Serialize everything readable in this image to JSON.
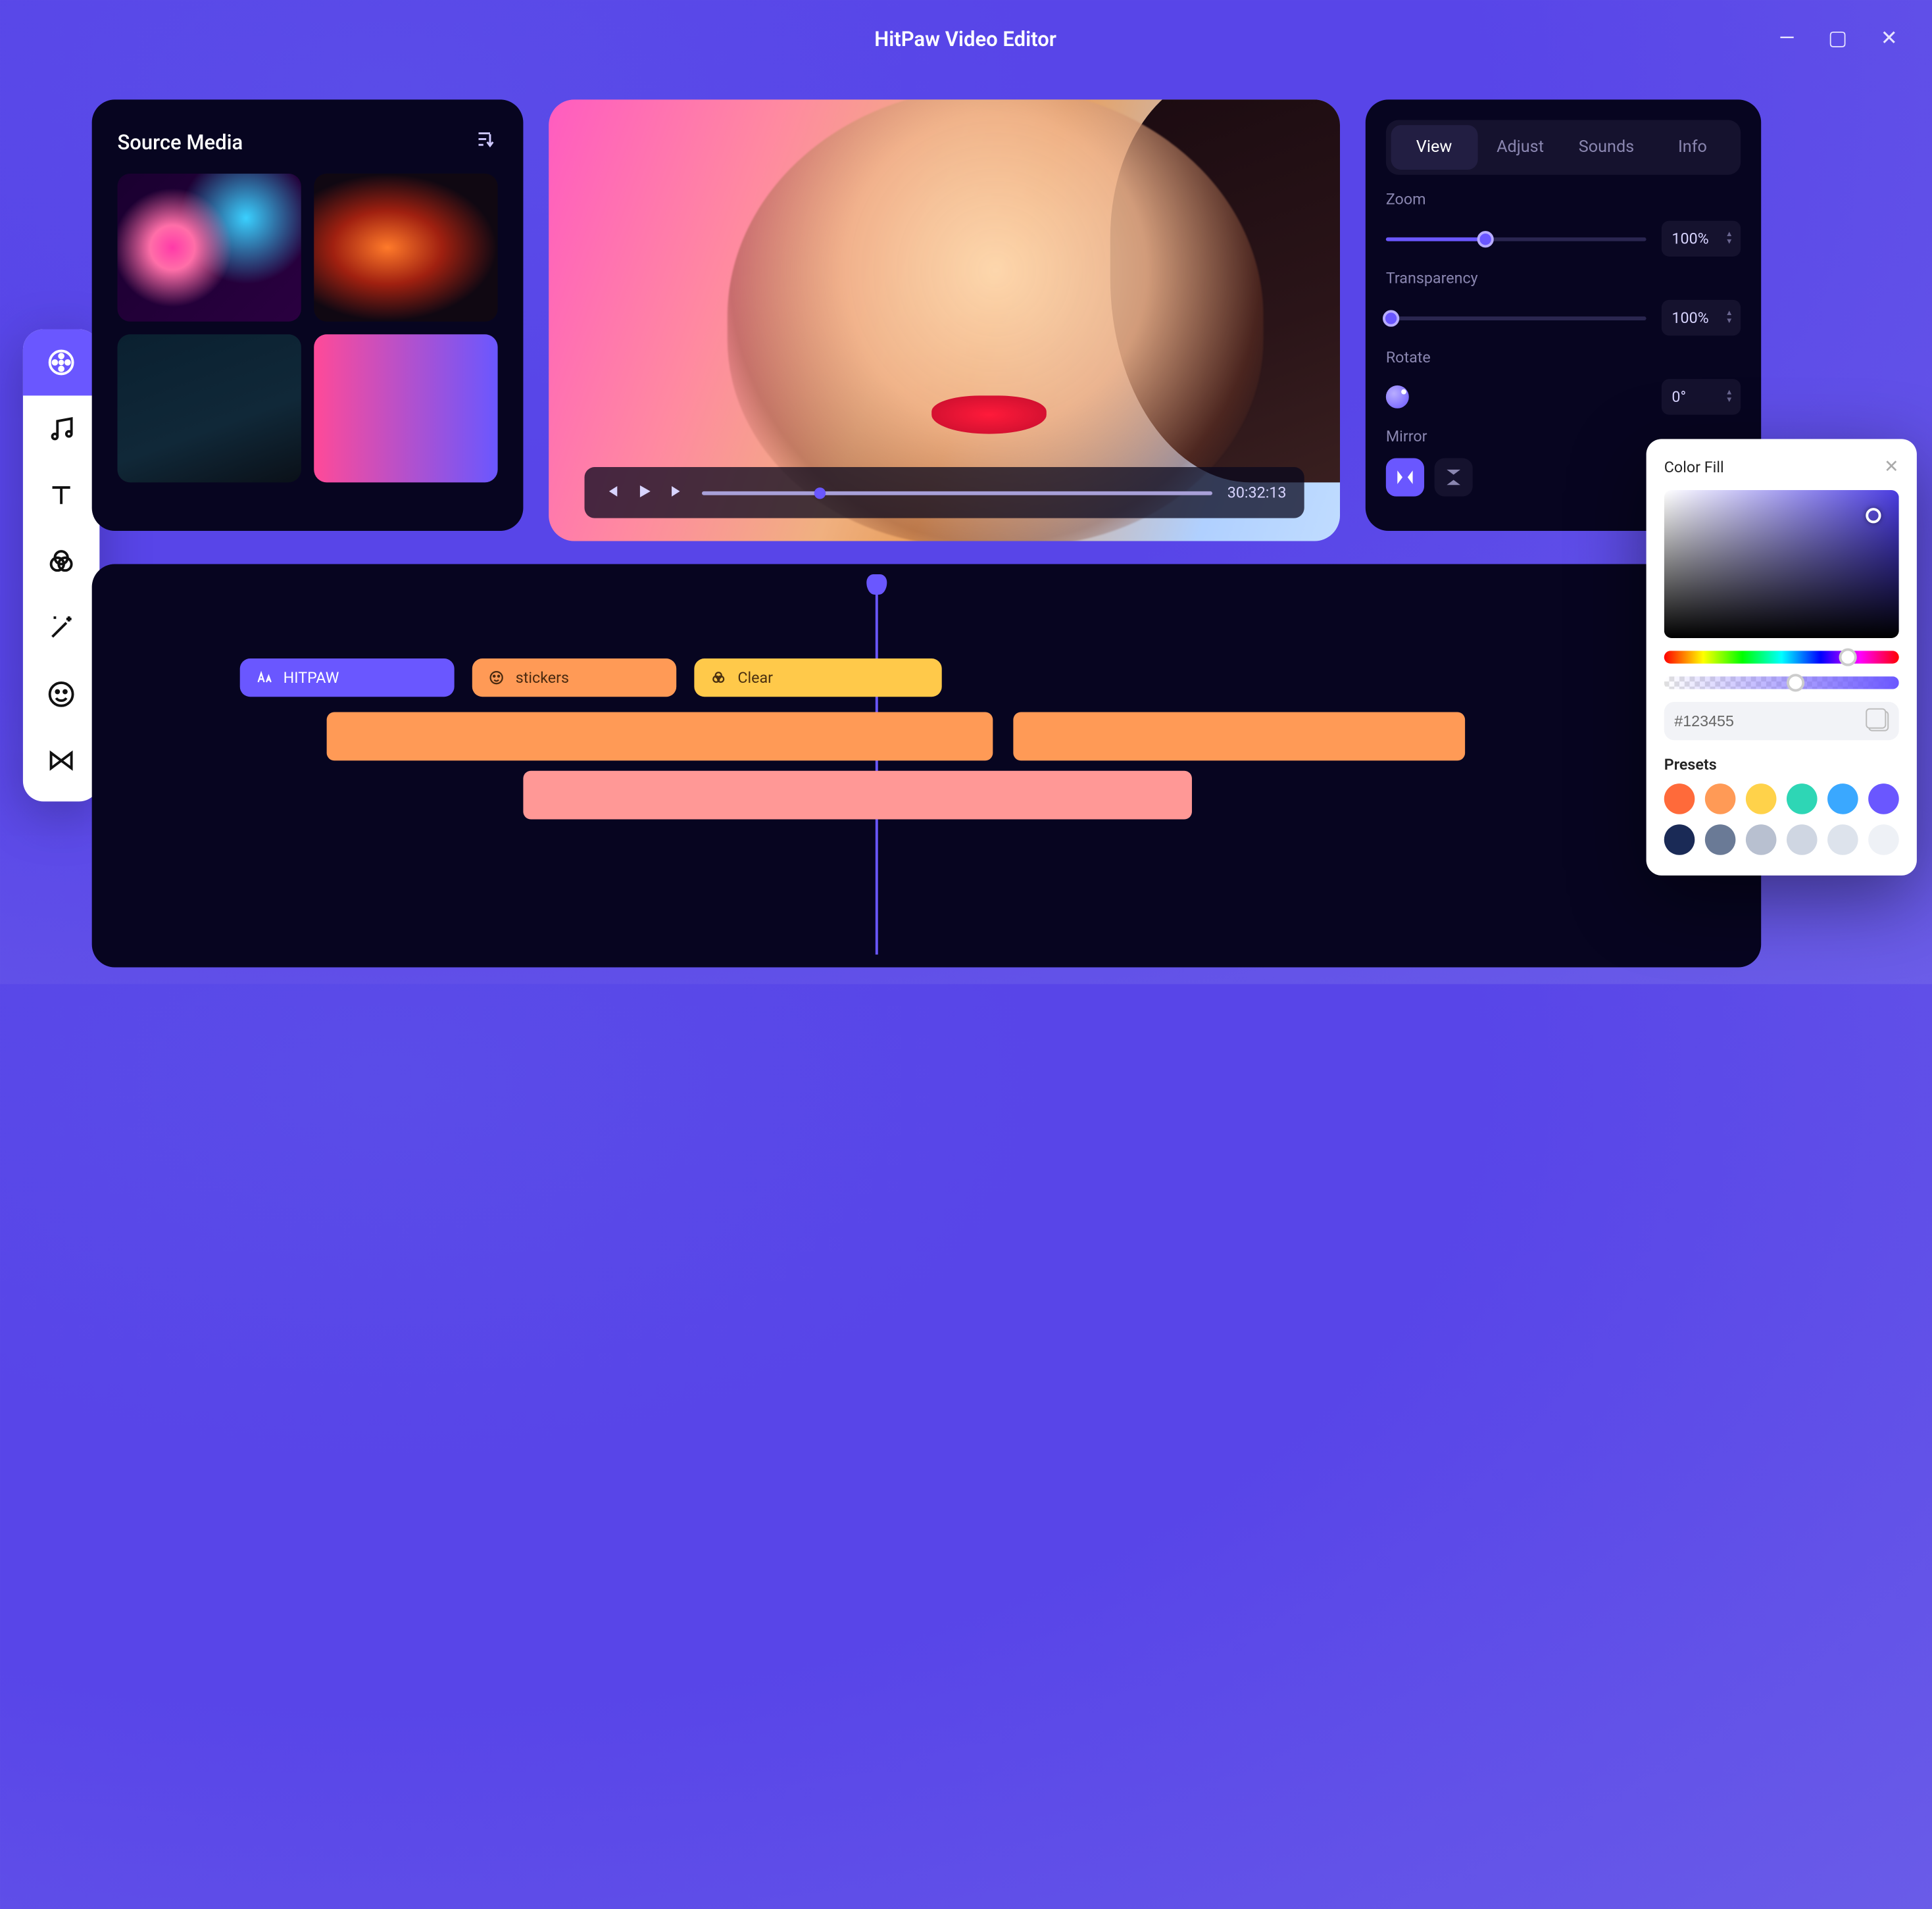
{
  "title": "HitPaw Video Editor",
  "source": {
    "heading": "Source Media"
  },
  "preview": {
    "time": "30:32:13"
  },
  "controls": {
    "tabs": [
      "View",
      "Adjust",
      "Sounds",
      "Info"
    ],
    "active_tab": "View",
    "zoom": {
      "label": "Zoom",
      "value": "100%",
      "fill": 38
    },
    "transparency": {
      "label": "Transparency",
      "value": "100%",
      "fill": 2
    },
    "rotate": {
      "label": "Rotate",
      "value": "0°"
    },
    "mirror": {
      "label": "Mirror"
    }
  },
  "timeline": {
    "chips": [
      {
        "label": "HITPAW"
      },
      {
        "label": "stickers"
      },
      {
        "label": "Clear"
      }
    ]
  },
  "picker": {
    "title": "Color Fill",
    "hex": "#123455",
    "presets_label": "Presets",
    "swatches": [
      "#ff6a3a",
      "#ff9a56",
      "#ffd24a",
      "#2ed6b5",
      "#3aa8ff",
      "#6a57ff",
      "#1a2a56",
      "#6a7a96",
      "#b8c0d0",
      "#cfd6e2",
      "#dde3ec",
      "#eef1f6"
    ]
  },
  "sidebar": {
    "items": [
      "media",
      "audio",
      "text",
      "effects",
      "magic",
      "stickers",
      "transitions"
    ]
  }
}
